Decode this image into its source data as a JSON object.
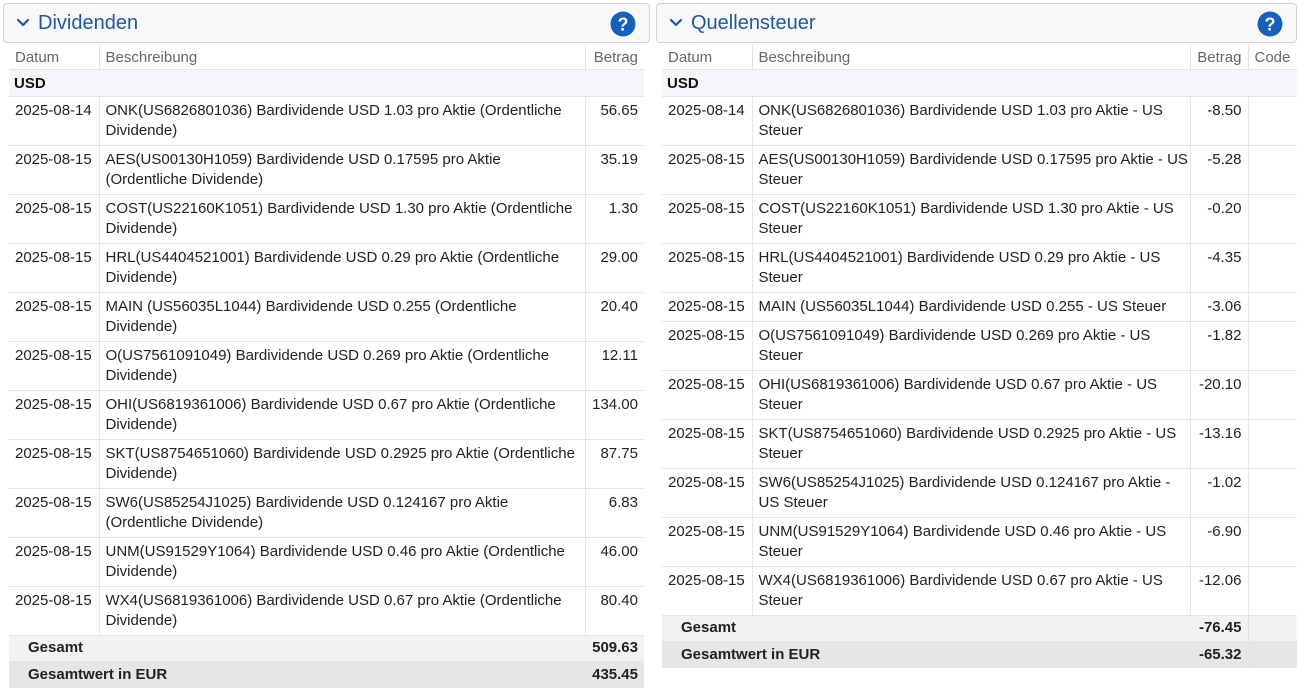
{
  "dividends": {
    "title": "Dividenden",
    "headers": {
      "date": "Datum",
      "desc": "Beschreibung",
      "amount": "Betrag"
    },
    "currency": "USD",
    "rows": [
      {
        "date": "2025-08-14",
        "desc": "ONK(US6826801036) Bardividende USD 1.03 pro Aktie (Ordentliche Dividende)",
        "amount": "56.65"
      },
      {
        "date": "2025-08-15",
        "desc": "AES(US00130H1059) Bardividende USD 0.17595 pro Aktie (Ordentliche Dividende)",
        "amount": "35.19"
      },
      {
        "date": "2025-08-15",
        "desc": "COST(US22160K1051) Bardividende USD 1.30 pro Aktie (Ordentliche Dividende)",
        "amount": "1.30"
      },
      {
        "date": "2025-08-15",
        "desc": "HRL(US4404521001) Bardividende USD 0.29 pro Aktie (Ordentliche Dividende)",
        "amount": "29.00"
      },
      {
        "date": "2025-08-15",
        "desc": "MAIN (US56035L1044) Bardividende USD 0.255 (Ordentliche Dividende)",
        "amount": "20.40"
      },
      {
        "date": "2025-08-15",
        "desc": "O(US7561091049) Bardividende USD 0.269 pro Aktie (Ordentliche Dividende)",
        "amount": "12.11"
      },
      {
        "date": "2025-08-15",
        "desc": "OHI(US6819361006) Bardividende USD 0.67 pro Aktie (Ordentliche Dividende)",
        "amount": "134.00"
      },
      {
        "date": "2025-08-15",
        "desc": "SKT(US8754651060) Bardividende USD 0.2925 pro Aktie (Ordentliche Dividende)",
        "amount": "87.75"
      },
      {
        "date": "2025-08-15",
        "desc": "SW6(US85254J1025) Bardividende USD 0.124167 pro Aktie (Ordentliche Dividende)",
        "amount": "6.83"
      },
      {
        "date": "2025-08-15",
        "desc": "UNM(US91529Y1064) Bardividende USD 0.46 pro Aktie (Ordentliche Dividende)",
        "amount": "46.00"
      },
      {
        "date": "2025-08-15",
        "desc": "WX4(US6819361006) Bardividende USD 0.67 pro Aktie (Ordentliche Dividende)",
        "amount": "80.40"
      }
    ],
    "total_label": "Gesamt",
    "total": "509.63",
    "eur_label": "Gesamtwert in EUR",
    "eur_total": "435.45"
  },
  "withholding": {
    "title": "Quellensteuer",
    "headers": {
      "date": "Datum",
      "desc": "Beschreibung",
      "amount": "Betrag",
      "code": "Code"
    },
    "currency": "USD",
    "rows": [
      {
        "date": "2025-08-14",
        "desc": "ONK(US6826801036) Bardividende USD 1.03 pro Aktie - US Steuer",
        "amount": "-8.50",
        "code": ""
      },
      {
        "date": "2025-08-15",
        "desc": "AES(US00130H1059) Bardividende USD 0.17595 pro Aktie - US Steuer",
        "amount": "-5.28",
        "code": ""
      },
      {
        "date": "2025-08-15",
        "desc": "COST(US22160K1051) Bardividende USD 1.30 pro Aktie - US Steuer",
        "amount": "-0.20",
        "code": ""
      },
      {
        "date": "2025-08-15",
        "desc": "HRL(US4404521001) Bardividende USD 0.29 pro Aktie - US Steuer",
        "amount": "-4.35",
        "code": ""
      },
      {
        "date": "2025-08-15",
        "desc": "MAIN (US56035L1044) Bardividende USD 0.255 - US Steuer",
        "amount": "-3.06",
        "code": ""
      },
      {
        "date": "2025-08-15",
        "desc": "O(US7561091049) Bardividende USD 0.269 pro Aktie - US Steuer",
        "amount": "-1.82",
        "code": ""
      },
      {
        "date": "2025-08-15",
        "desc": "OHI(US6819361006) Bardividende USD 0.67 pro Aktie - US Steuer",
        "amount": "-20.10",
        "code": ""
      },
      {
        "date": "2025-08-15",
        "desc": "SKT(US8754651060) Bardividende USD 0.2925 pro Aktie - US Steuer",
        "amount": "-13.16",
        "code": ""
      },
      {
        "date": "2025-08-15",
        "desc": "SW6(US85254J1025) Bardividende USD 0.124167 pro Aktie - US Steuer",
        "amount": "-1.02",
        "code": ""
      },
      {
        "date": "2025-08-15",
        "desc": "UNM(US91529Y1064) Bardividende USD 0.46 pro Aktie - US Steuer",
        "amount": "-6.90",
        "code": ""
      },
      {
        "date": "2025-08-15",
        "desc": "WX4(US6819361006) Bardividende USD 0.67 pro Aktie - US Steuer",
        "amount": "-12.06",
        "code": ""
      }
    ],
    "total_label": "Gesamt",
    "total": "-76.45",
    "eur_label": "Gesamtwert in EUR",
    "eur_total": "-65.32"
  },
  "colors": {
    "accent": "#1f57a8",
    "help": "#1560bd"
  },
  "icons": {
    "collapse": "chevron-down-icon",
    "help": "help-icon"
  }
}
